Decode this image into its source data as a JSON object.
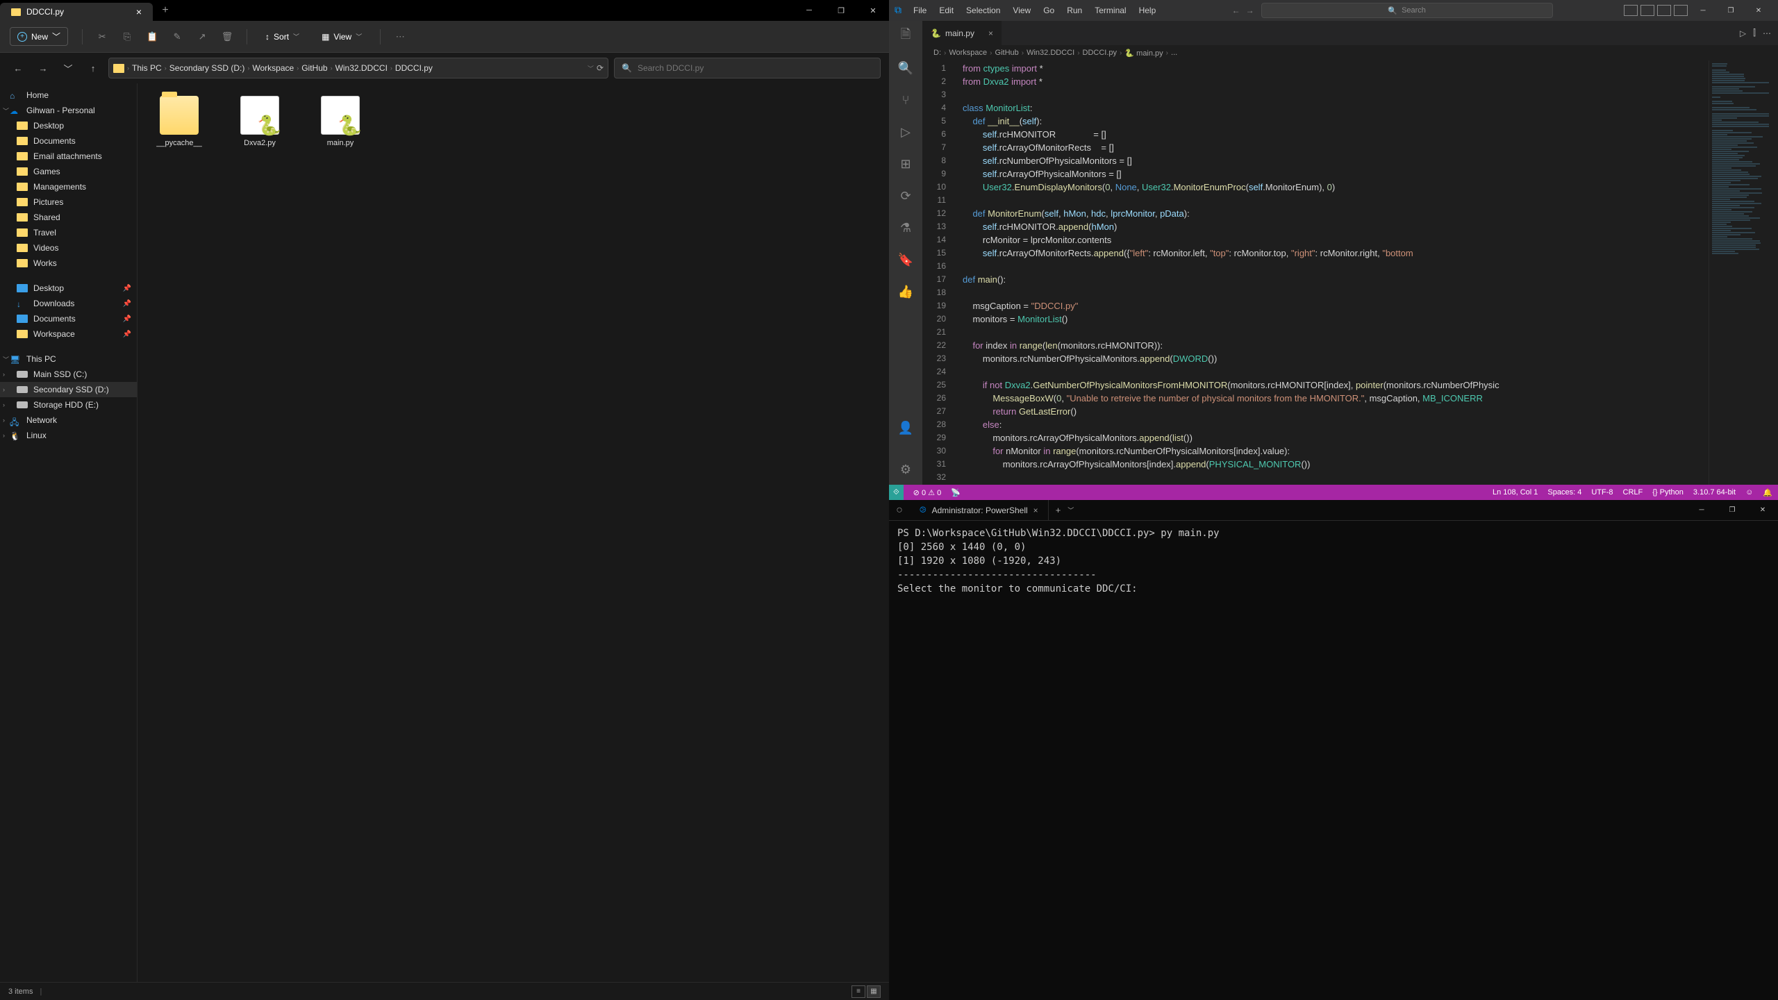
{
  "explorer": {
    "tab_title": "DDCCI.py",
    "new_btn": "New",
    "toolbar": {
      "sort": "Sort",
      "view": "View"
    },
    "breadcrumb": [
      "This PC",
      "Secondary SSD (D:)",
      "Workspace",
      "GitHub",
      "Win32.DDCCI",
      "DDCCI.py"
    ],
    "search_placeholder": "Search DDCCI.py",
    "sidebar": {
      "home": "Home",
      "onedrive": "Gihwan - Personal",
      "quick": [
        "Desktop",
        "Documents",
        "Email attachments",
        "Games",
        "Managements",
        "Pictures",
        "Shared",
        "Travel",
        "Videos",
        "Works"
      ],
      "pinned": [
        "Desktop",
        "Downloads",
        "Documents",
        "Workspace"
      ],
      "thispc": "This PC",
      "drives": [
        "Main SSD (C:)",
        "Secondary SSD (D:)",
        "Storage HDD (E:)"
      ],
      "network": "Network",
      "linux": "Linux"
    },
    "files": [
      {
        "name": "__pycache__",
        "type": "folder"
      },
      {
        "name": "Dxva2.py",
        "type": "py"
      },
      {
        "name": "main.py",
        "type": "py"
      }
    ],
    "status": "3 items"
  },
  "vscode": {
    "menu": [
      "File",
      "Edit",
      "Selection",
      "View",
      "Go",
      "Run",
      "Terminal",
      "Help"
    ],
    "search_placeholder": "Search",
    "tab": "main.py",
    "breadcrumb": [
      "D:",
      "Workspace",
      "GitHub",
      "Win32.DDCCI",
      "DDCCI.py",
      "main.py",
      "..."
    ],
    "code_lines": [
      {
        "n": 1,
        "html": "<span class='k'>from</span> <span class='cl'>ctypes</span> <span class='k'>import</span> *"
      },
      {
        "n": 2,
        "html": "<span class='k'>from</span> <span class='cl'>Dxva2</span> <span class='k'>import</span> *"
      },
      {
        "n": 3,
        "html": ""
      },
      {
        "n": 4,
        "html": "<span class='kt'>class</span> <span class='cl'>MonitorList</span>:"
      },
      {
        "n": 5,
        "html": "    <span class='kt'>def</span> <span class='fn'>__init__</span>(<span class='p'>self</span>):"
      },
      {
        "n": 6,
        "html": "        <span class='p'>self</span>.rcHMONITOR               = []"
      },
      {
        "n": 7,
        "html": "        <span class='p'>self</span>.rcArrayOfMonitorRects    = []"
      },
      {
        "n": 8,
        "html": "        <span class='p'>self</span>.rcNumberOfPhysicalMonitors = []"
      },
      {
        "n": 9,
        "html": "        <span class='p'>self</span>.rcArrayOfPhysicalMonitors = []"
      },
      {
        "n": 10,
        "html": "        <span class='cl'>User32</span>.<span class='fn'>EnumDisplayMonitors</span>(<span class='n'>0</span>, <span class='kt'>None</span>, <span class='cl'>User32</span>.<span class='fn'>MonitorEnumProc</span>(<span class='p'>self</span>.MonitorEnum), <span class='n'>0</span>)"
      },
      {
        "n": 11,
        "html": ""
      },
      {
        "n": 12,
        "html": "    <span class='kt'>def</span> <span class='fn'>MonitorEnum</span>(<span class='p'>self</span>, <span class='p'>hMon</span>, <span class='p'>hdc</span>, <span class='p'>lprcMonitor</span>, <span class='p'>pData</span>):"
      },
      {
        "n": 13,
        "html": "        <span class='p'>self</span>.rcHMONITOR.<span class='fn'>append</span>(<span class='p'>hMon</span>)"
      },
      {
        "n": 14,
        "html": "        rcMonitor = lprcMonitor.contents"
      },
      {
        "n": 15,
        "html": "        <span class='p'>self</span>.rcArrayOfMonitorRects.<span class='fn'>append</span>({<span class='s'>\"left\"</span>: rcMonitor.left, <span class='s'>\"top\"</span>: rcMonitor.top, <span class='s'>\"right\"</span>: rcMonitor.right, <span class='s'>\"bottom</span>"
      },
      {
        "n": 16,
        "html": ""
      },
      {
        "n": 17,
        "html": "<span class='kt'>def</span> <span class='fn'>main</span>():"
      },
      {
        "n": 18,
        "html": ""
      },
      {
        "n": 19,
        "html": "    msgCaption = <span class='s'>\"DDCCI.py\"</span>"
      },
      {
        "n": 20,
        "html": "    monitors = <span class='cl'>MonitorList</span>()"
      },
      {
        "n": 21,
        "html": ""
      },
      {
        "n": 22,
        "html": "    <span class='k'>for</span> index <span class='k'>in</span> <span class='fn'>range</span>(<span class='fn'>len</span>(monitors.rcHMONITOR)):"
      },
      {
        "n": 23,
        "html": "        monitors.rcNumberOfPhysicalMonitors.<span class='fn'>append</span>(<span class='cl'>DWORD</span>())"
      },
      {
        "n": 24,
        "html": ""
      },
      {
        "n": 25,
        "html": "        <span class='k'>if</span> <span class='k'>not</span> <span class='cl'>Dxva2</span>.<span class='fn'>GetNumberOfPhysicalMonitorsFromHMONITOR</span>(monitors.rcHMONITOR[index], <span class='fn'>pointer</span>(monitors.rcNumberOfPhysic"
      },
      {
        "n": 26,
        "html": "            <span class='fn'>MessageBoxW</span>(<span class='n'>0</span>, <span class='s'>\"Unable to retreive the number of physical monitors from the HMONITOR.\"</span>, msgCaption, <span class='cl'>MB_ICONERR</span>"
      },
      {
        "n": 27,
        "html": "            <span class='k'>return</span> <span class='fn'>GetLastError</span>()"
      },
      {
        "n": 28,
        "html": "        <span class='k'>else</span>:"
      },
      {
        "n": 29,
        "html": "            monitors.rcArrayOfPhysicalMonitors.<span class='fn'>append</span>(<span class='fn'>list</span>())"
      },
      {
        "n": 30,
        "html": "            <span class='k'>for</span> nMonitor <span class='k'>in</span> <span class='fn'>range</span>(monitors.rcNumberOfPhysicalMonitors[index].value):"
      },
      {
        "n": 31,
        "html": "                monitors.rcArrayOfPhysicalMonitors[index].<span class='fn'>append</span>(<span class='cl'>PHYSICAL_MONITOR</span>())"
      },
      {
        "n": 32,
        "html": ""
      }
    ],
    "status": {
      "errors": "0",
      "warnings": "0",
      "position": "Ln 108, Col 1",
      "spaces": "Spaces: 4",
      "encoding": "UTF-8",
      "eol": "CRLF",
      "lang": "Python",
      "interpreter": "3.10.7 64-bit"
    }
  },
  "terminal": {
    "tab": "Administrator: PowerShell",
    "lines": [
      "PS D:\\Workspace\\GitHub\\Win32.DDCCI\\DDCCI.py> py main.py",
      "[0] 2560 x 1440 (0, 0)",
      "[1] 1920 x 1080 (-1920, 243)",
      "----------------------------------",
      "Select the monitor to communicate DDC/CI:"
    ]
  }
}
